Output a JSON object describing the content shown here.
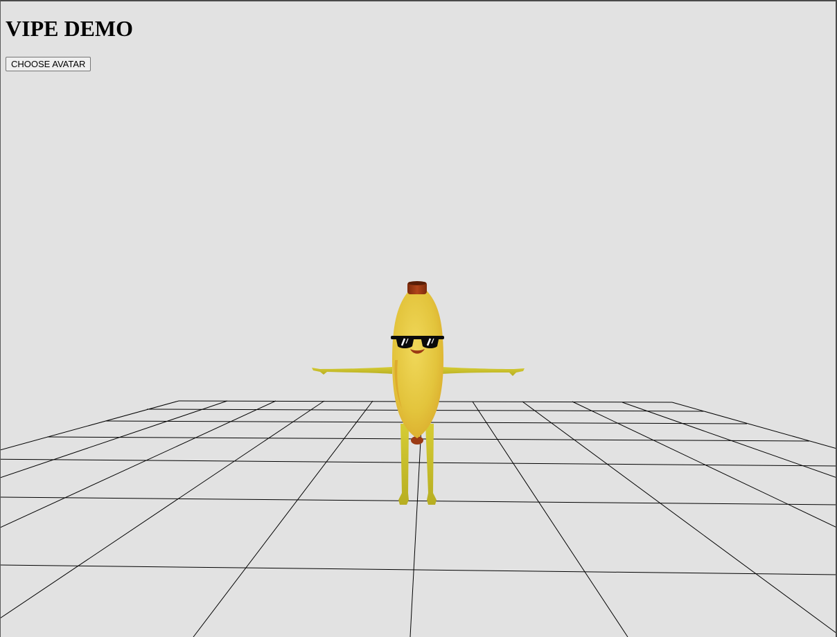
{
  "page": {
    "title": "VIPE DEMO",
    "choose_avatar_label": "CHOOSE AVATAR"
  },
  "viewport": {
    "background_color": "#e2e2e2",
    "grid_color": "#000000"
  },
  "avatar": {
    "type": "banana",
    "pose": "T-pose",
    "accessory": "sunglasses",
    "body_color": "#e3c43c",
    "cap_color": "#9b3a14",
    "limb_color": "#c9c02a",
    "glasses_color": "#0a0a0a"
  }
}
